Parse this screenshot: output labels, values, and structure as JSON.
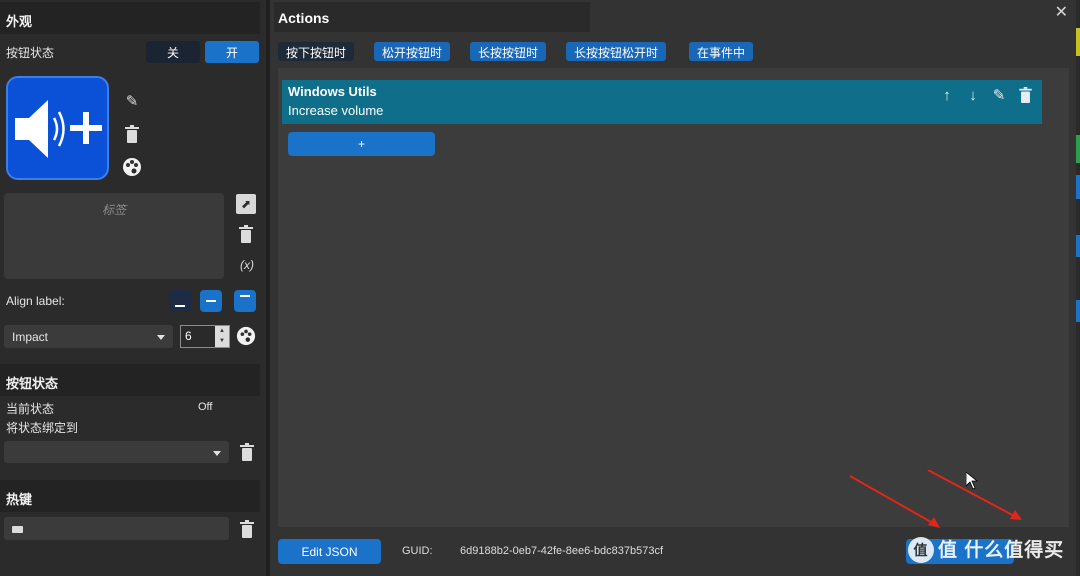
{
  "left": {
    "appearance_header": "外观",
    "button_state_label": "按钮状态",
    "toggle_off": "关",
    "toggle_on": "开",
    "label_placeholder": "标签",
    "variable_icon": "(x)",
    "align_label": "Align label:",
    "font_name": "Impact",
    "font_size": "6",
    "state_header": "按钮状态",
    "current_state_label": "当前状态",
    "current_state_value": "Off",
    "bind_state_label": "将状态绑定到",
    "bind_state_value": "",
    "hotkey_header": "热键",
    "hotkey_value": ""
  },
  "right": {
    "title": "Actions",
    "close": "✕",
    "tabs": [
      "按下按钮时",
      "松开按钮时",
      "长按按钮时",
      "长按按钮松开时",
      "在事件中"
    ],
    "active_tab": 0,
    "action": {
      "title": "Windows Utils",
      "subtitle": "Increase volume"
    },
    "add_label": "+",
    "edit_json_label": "Edit JSON",
    "guid_label": "GUID:",
    "guid_value": "6d9188b2-0eb7-42fe-8ee6-bdc837b573cf",
    "done_label": "",
    "watermark": "值 什么值得买"
  },
  "colors": {
    "accent": "#1a73c9",
    "action_row": "#0f6f8a",
    "icon_bg": "#0a51d8",
    "arrow": "#e0261b"
  }
}
